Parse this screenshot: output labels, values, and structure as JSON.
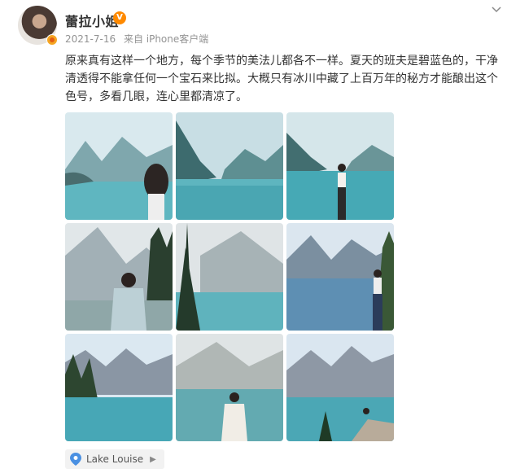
{
  "post": {
    "username": "蕾拉小姐",
    "date": "2021-7-16",
    "source": "来自 iPhone客户端",
    "text": "原来真有这样一个地方，每个季节的美法儿都各不一样。夏天的班夫是碧蓝色的，干净清透得不能拿任何一个宝石来比拟。大概只有冰川中藏了上百万年的秘方才能酿出这个色号，多看几眼，连心里都清凉了。",
    "location": "Lake Louise"
  },
  "icons": {
    "vip": "vip-badge-icon",
    "verified": "verified-badge-icon",
    "menu": "chevron-down-icon",
    "location": "map-pin-icon",
    "location_arrow": "chevron-right-icon"
  },
  "colors": {
    "text": "#333333",
    "meta": "#939393",
    "accent": "#ff8a00",
    "location_bg": "#f2f2f2"
  },
  "photos": [
    {
      "scene": "lake-girl-with-hat"
    },
    {
      "scene": "lake-mountains"
    },
    {
      "scene": "girl-standing-lake"
    },
    {
      "scene": "girl-rocks-mountains"
    },
    {
      "scene": "pines-lake"
    },
    {
      "scene": "girl-lakeside"
    },
    {
      "scene": "mountain-reflection"
    },
    {
      "scene": "girl-sitting-lake"
    },
    {
      "scene": "girl-on-rock"
    }
  ]
}
